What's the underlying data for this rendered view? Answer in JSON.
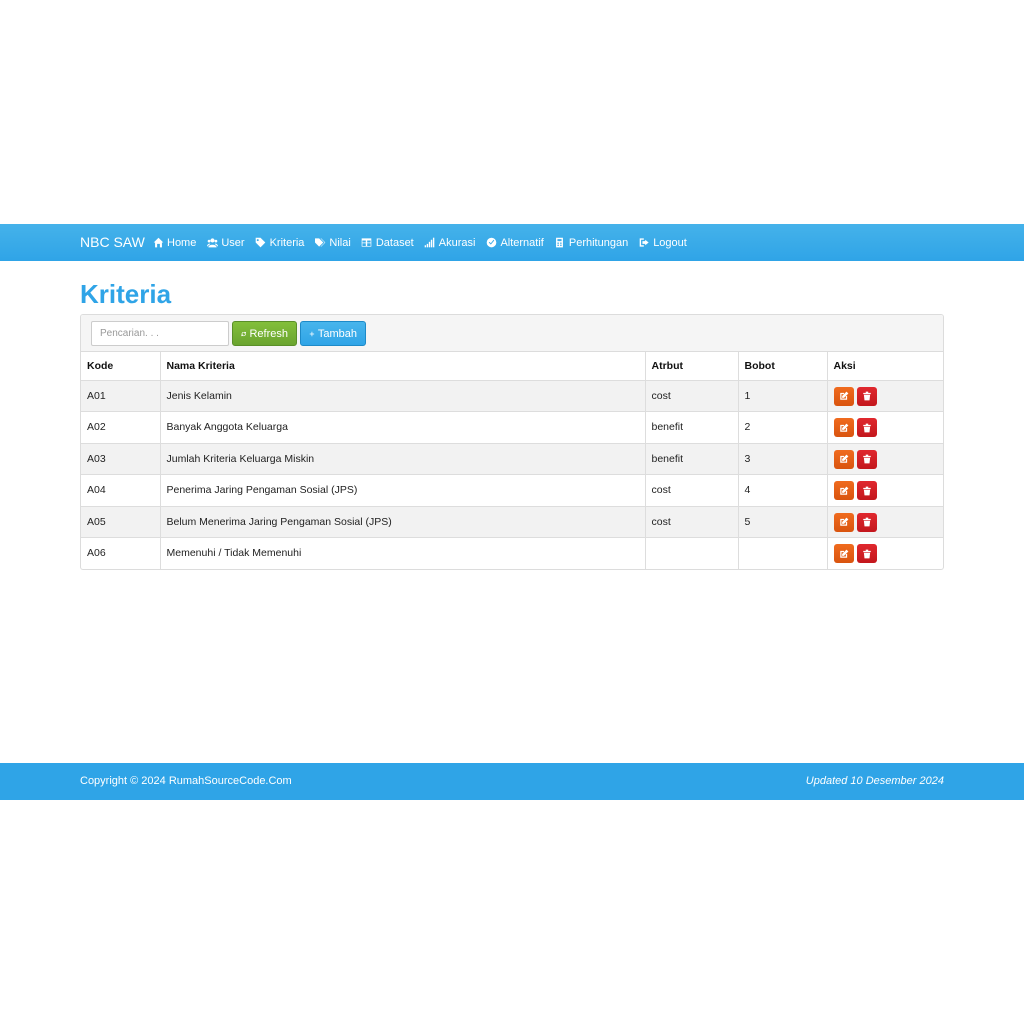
{
  "navbar": {
    "brand": "NBC SAW",
    "items": [
      {
        "label": "Home",
        "icon": "home-icon"
      },
      {
        "label": "User",
        "icon": "users-icon"
      },
      {
        "label": "Kriteria",
        "icon": "tag-icon"
      },
      {
        "label": "Nilai",
        "icon": "tags-icon"
      },
      {
        "label": "Dataset",
        "icon": "table-icon"
      },
      {
        "label": "Akurasi",
        "icon": "signal-icon"
      },
      {
        "label": "Alternatif",
        "icon": "check-circle-icon"
      },
      {
        "label": "Perhitungan",
        "icon": "calculator-icon"
      },
      {
        "label": "Logout",
        "icon": "sign-out-icon"
      }
    ]
  },
  "page": {
    "title": "Kriteria"
  },
  "toolbar": {
    "search_placeholder": "Pencarian. . .",
    "refresh_label": "Refresh",
    "add_label": "Tambah"
  },
  "table": {
    "headers": [
      "Kode",
      "Nama Kriteria",
      "Atrbut",
      "Bobot",
      "Aksi"
    ],
    "rows": [
      {
        "kode": "A01",
        "nama": "Jenis Kelamin",
        "atribut": "cost",
        "bobot": "1"
      },
      {
        "kode": "A02",
        "nama": "Banyak Anggota Keluarga",
        "atribut": "benefit",
        "bobot": "2"
      },
      {
        "kode": "A03",
        "nama": "Jumlah Kriteria Keluarga Miskin",
        "atribut": "benefit",
        "bobot": "3"
      },
      {
        "kode": "A04",
        "nama": "Penerima Jaring Pengaman Sosial (JPS)",
        "atribut": "cost",
        "bobot": "4"
      },
      {
        "kode": "A05",
        "nama": "Belum Menerima Jaring Pengaman Sosial (JPS)",
        "atribut": "cost",
        "bobot": "5"
      },
      {
        "kode": "A06",
        "nama": "Memenuhi / Tidak Memenuhi",
        "atribut": "",
        "bobot": ""
      }
    ]
  },
  "footer": {
    "copyright": "Copyright © 2024 RumahSourceCode.Com",
    "updated": "Updated 10 Desember 2024"
  },
  "colors": {
    "primary": "#2fa4e7",
    "success": "#73a839",
    "warning": "#dd5600",
    "danger": "#c71c22"
  }
}
